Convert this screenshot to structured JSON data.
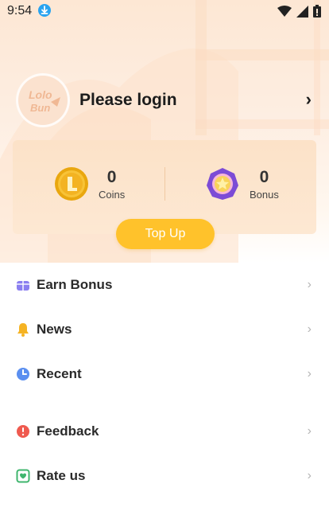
{
  "status": {
    "time": "9:54"
  },
  "profile": {
    "login_text": "Please login",
    "avatar_logo": "Lolo Bun"
  },
  "wallet": {
    "coins": {
      "value": "0",
      "label": "Coins"
    },
    "bonus": {
      "value": "0",
      "label": "Bonus"
    },
    "topup_label": "Top Up"
  },
  "menu": {
    "items": [
      {
        "label": "Earn Bonus",
        "icon": "gift-icon",
        "color": "#8b7ff0"
      },
      {
        "label": "News",
        "icon": "bell-icon",
        "color": "#f5b323"
      },
      {
        "label": "Recent",
        "icon": "clock-icon",
        "color": "#5b8ff0"
      },
      {
        "label": "Feedback",
        "icon": "alert-icon",
        "color": "#ef5a4f"
      },
      {
        "label": "Rate us",
        "icon": "rate-icon",
        "color": "#3fb56d"
      }
    ]
  }
}
